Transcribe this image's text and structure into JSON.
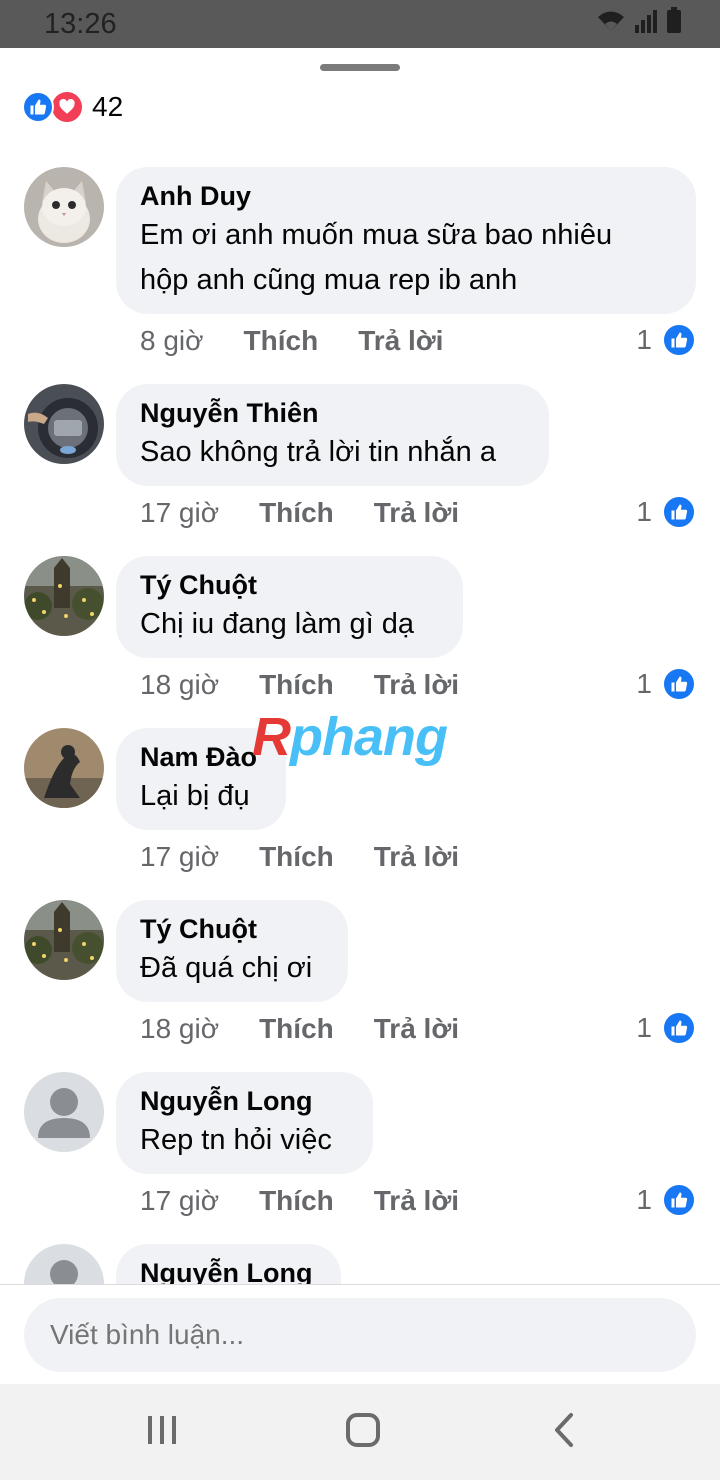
{
  "status_bar": {
    "time": "13:26"
  },
  "reactions": {
    "count": "42"
  },
  "comments": [
    {
      "author": "Anh Duy",
      "lines": [
        "Em ơi anh muốn mua sữa bao nhiêu",
        "hộp anh cũng mua rep ib anh"
      ],
      "time": "8 giờ",
      "like_label": "Thích",
      "reply_label": "Trả lời",
      "likes": "1"
    },
    {
      "author": "Nguyễn Thiên",
      "lines": [
        "Sao không trả lời tin nhắn a"
      ],
      "time": "17 giờ",
      "like_label": "Thích",
      "reply_label": "Trả lời",
      "likes": "1"
    },
    {
      "author": "Tý Chuột",
      "lines": [
        "Chị iu đang làm gì dạ"
      ],
      "time": "18 giờ",
      "like_label": "Thích",
      "reply_label": "Trả lời",
      "likes": "1"
    },
    {
      "author": "Nam Đào",
      "lines": [
        "Lại bị đụ"
      ],
      "time": "17 giờ",
      "like_label": "Thích",
      "reply_label": "Trả lời",
      "likes": ""
    },
    {
      "author": "Tý Chuột",
      "lines": [
        "Đã quá chị ơi"
      ],
      "time": "18 giờ",
      "like_label": "Thích",
      "reply_label": "Trả lời",
      "likes": "1"
    },
    {
      "author": "Nguyễn Long",
      "lines": [
        "Rep tn hỏi việc"
      ],
      "time": "17 giờ",
      "like_label": "Thích",
      "reply_label": "Trả lời",
      "likes": "1"
    },
    {
      "author": "Nguyễn Long",
      "lines": [],
      "time": "",
      "like_label": "",
      "reply_label": "",
      "likes": ""
    }
  ],
  "watermark": {
    "part1": "R",
    "part2": "phang"
  },
  "composer": {
    "placeholder": "Viết bình luận..."
  },
  "colors": {
    "accent": "#1877f2",
    "love": "#f33e58",
    "bubble": "#f0f2f5",
    "meta": "#65676b"
  },
  "icons": {
    "like": "like-icon",
    "love": "heart-icon",
    "wifi": "wifi-icon",
    "signal": "signal-icon",
    "battery": "battery-icon"
  }
}
